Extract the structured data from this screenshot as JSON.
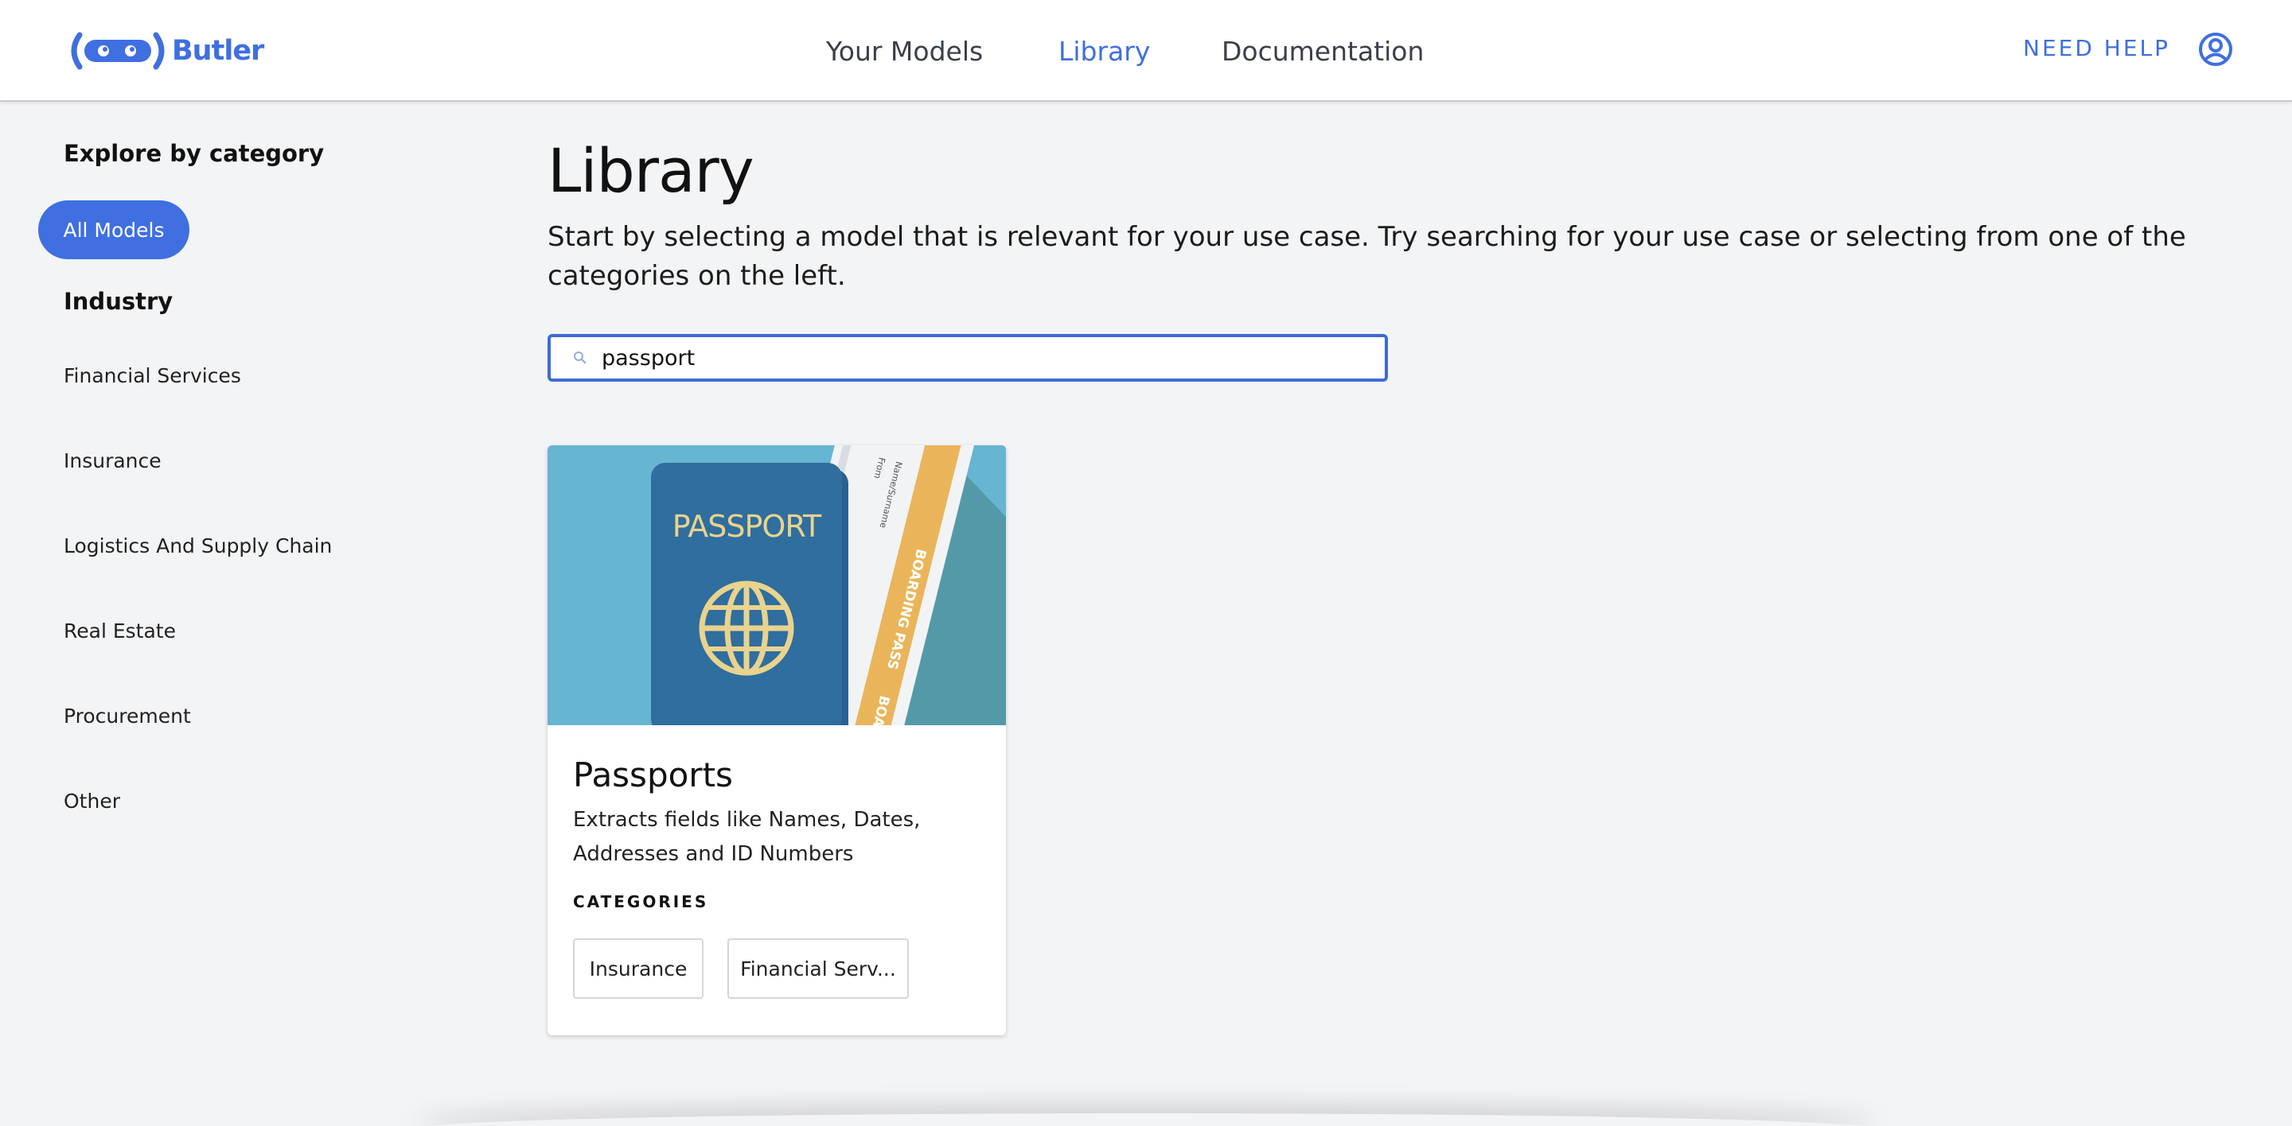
{
  "header": {
    "logo_text": "Butler",
    "nav": [
      {
        "label": "Your Models"
      },
      {
        "label": "Library"
      },
      {
        "label": "Documentation"
      }
    ],
    "need_help_label": "NEED HELP",
    "icons": {
      "user": "user-circle-icon",
      "logo": "butler-logo-icon"
    }
  },
  "sidebar": {
    "explore_title": "Explore by category",
    "all_models_label": "All Models",
    "industry_title": "Industry",
    "categories": [
      {
        "label": "Financial Services"
      },
      {
        "label": "Insurance"
      },
      {
        "label": "Logistics And Supply Chain"
      },
      {
        "label": "Real Estate"
      },
      {
        "label": "Procurement"
      },
      {
        "label": "Other"
      }
    ]
  },
  "main": {
    "title": "Library",
    "description": "Start by selecting a model that is relevant for your use case. Try searching for your use case or selecting from one of the categories on the left.",
    "search": {
      "value": "passport",
      "icon": "search-icon"
    },
    "cards": [
      {
        "title": "Passports",
        "description": "Extracts fields like Names, Dates, Addresses and ID Numbers",
        "categories_label": "CATEGORIES",
        "chips": [
          "Insurance",
          "Financial Serv..."
        ],
        "image": {
          "passport_text": "PASSPORT",
          "boarding_text": "BOARDING PASS",
          "boarding_text_2": "BOARDIN",
          "ticket_field_1": "Name/Surname",
          "ticket_field_2": "From"
        }
      }
    ]
  },
  "colors": {
    "accent": "#3f6fe0",
    "background": "#f3f4f6",
    "card_image_bg": "#66b5d1",
    "passport_blue": "#2f6e9e",
    "gold": "#e9d38e",
    "boarding_orange": "#eab55a"
  }
}
